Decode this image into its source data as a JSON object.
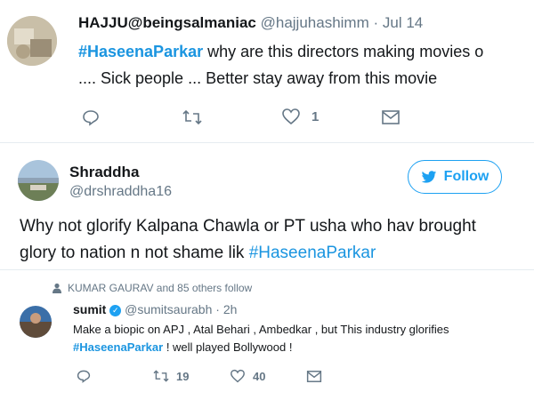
{
  "tweet1": {
    "display_name": "HAJJU@beingsalmaniac",
    "handle": "@hajjuhashimm",
    "separator": "·",
    "date": "Jul 14",
    "hashtag": "#HaseenaParkar",
    "text_line1_rest": " why are this directors making movies o",
    "text_line2": ".... Sick people ... Better stay away from this movie",
    "like_count": "1",
    "icons": [
      "reply-icon",
      "retweet-icon",
      "like-icon",
      "message-icon"
    ]
  },
  "tweet2": {
    "display_name": "Shraddha",
    "handle": "@drshraddha16",
    "follow_label": "Follow",
    "text_line1": "Why not glorify Kalpana Chawla or PT usha who hav brought",
    "text_line2_prefix": "glory to nation n not shame lik ",
    "hashtag": "#HaseenaParkar"
  },
  "tweet3": {
    "follow_context": "KUMAR GAURAV and 85 others follow",
    "display_name": "sumit",
    "handle": "@sumitsaurabh",
    "separator": "·",
    "time": "2h",
    "text_line1": "Make a biopic on APJ , Atal Behari , Ambedkar , but This industry glorifies",
    "hashtag": "#HaseenaParkar",
    "text_line2_rest": " ! well played Bollywood !",
    "retweet_count": "19",
    "like_count": "40"
  },
  "colors": {
    "accent": "#1da1f2",
    "hashtag": "#1b95e0",
    "muted": "#657786",
    "text": "#14171a"
  }
}
